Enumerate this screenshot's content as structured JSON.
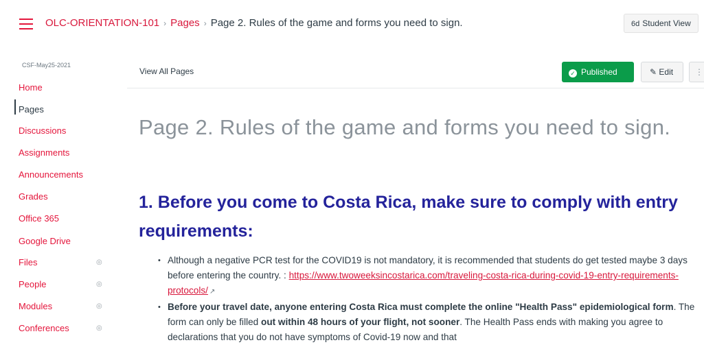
{
  "breadcrumb": {
    "course": "OLC-ORIENTATION-101",
    "section": "Pages",
    "current": "Page 2. Rules of the game and forms you need to sign."
  },
  "header_actions": {
    "student_view_icon": "6d",
    "student_view": "Student View"
  },
  "course_nav": {
    "course_code": "CSF-May25-2021",
    "items": [
      {
        "label": "Home",
        "active": false
      },
      {
        "label": "Pages",
        "active": true
      },
      {
        "label": "Discussions",
        "active": false
      },
      {
        "label": "Assignments",
        "active": false
      },
      {
        "label": "Announcements",
        "active": false
      },
      {
        "label": "Grades",
        "active": false
      },
      {
        "label": "Office 365",
        "active": false
      },
      {
        "label": "Google Drive",
        "active": false
      },
      {
        "label": "Files",
        "active": false,
        "hidden_icon": "eye-off-icon"
      },
      {
        "label": "People",
        "active": false,
        "hidden_icon": "eye-off-icon"
      },
      {
        "label": "Modules",
        "active": false,
        "hidden_icon": "eye-off-icon"
      },
      {
        "label": "Conferences",
        "active": false,
        "hidden_icon": "eye-off-icon"
      }
    ]
  },
  "content_header": {
    "view_all": "View All Pages",
    "published": "Published",
    "edit": "Edit",
    "more": "⋮"
  },
  "page": {
    "title": "Page 2. Rules of the game and forms you need to sign.",
    "heading": "1. Before you come to Costa Rica, make sure to comply with entry requirements:",
    "bullet1_text": "Although a negative PCR test for the COVID19 is not mandatory, it is recommended that students do get tested maybe 3 days before entering the country. : ",
    "bullet1_link": "https://www.twoweeksincostarica.com/traveling-costa-rica-during-covid-19-entry-requirements-protocols/",
    "bullet2_bold1": "Before your travel date, anyone entering Costa Rica must complete the online \"Health Pass\" epidemiological form",
    "bullet2_text1": ". The form can only be filled ",
    "bullet2_bold2": "out within 48 hours of your flight, not sooner",
    "bullet2_text2": ". The Health Pass ends with making you agree to declarations that you do not have symptoms of Covid-19 now and that"
  },
  "colors": {
    "brand_red": "#e4153b",
    "published_green": "#0b9c4a",
    "heading_blue": "#24239b"
  }
}
